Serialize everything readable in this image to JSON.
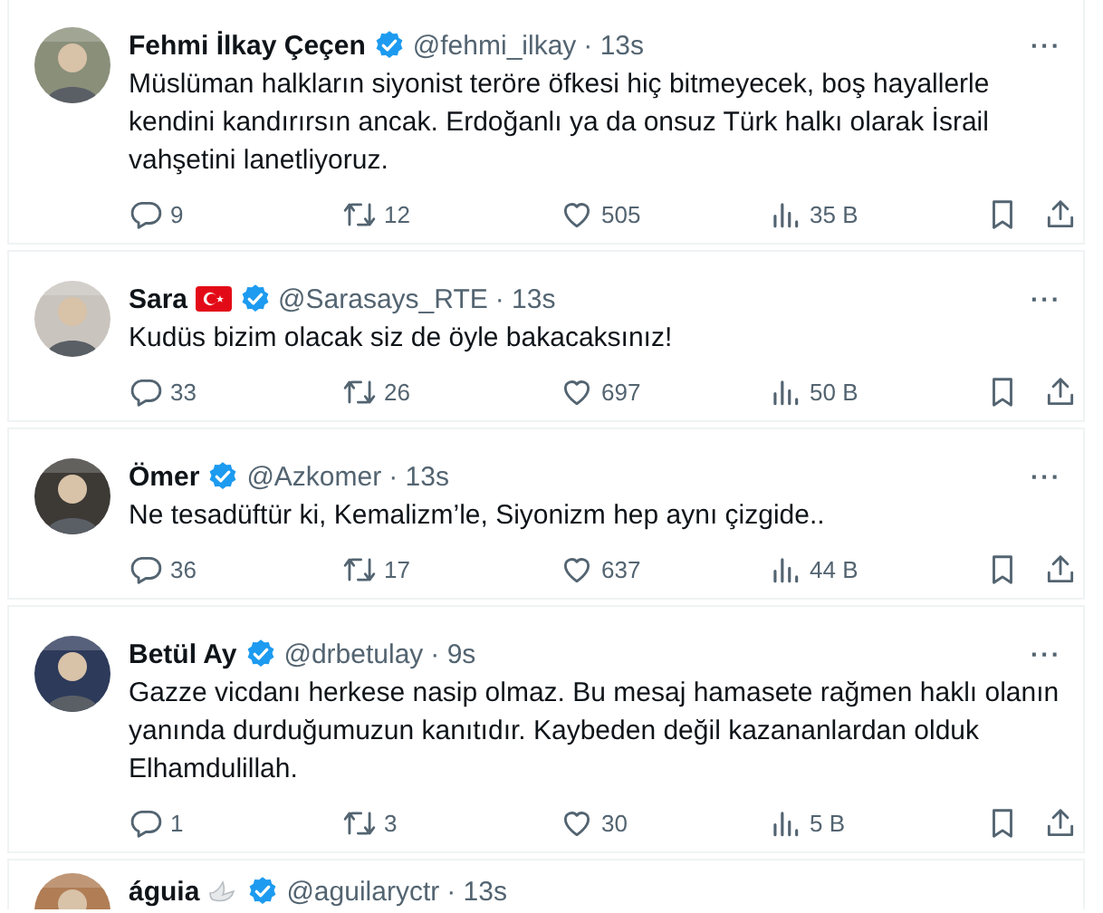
{
  "tweets": [
    {
      "name": "Fehmi İlkay Çeçen",
      "flag_badge": false,
      "dove_badge": false,
      "verified": true,
      "handle": "@fehmi_ilkay",
      "time": "· 13s",
      "more": "···",
      "text": "Müslüman halkların siyonist teröre öfkesi hiç bitmeyecek, boş hayallerle kendini kandırırsın ancak. Erdoğanlı ya da onsuz Türk halkı olarak İsrail vahşetini lanetliyoruz.",
      "replies": "9",
      "reposts": "12",
      "likes": "505",
      "views": "35 B"
    },
    {
      "name": "Sara",
      "flag_badge": true,
      "dove_badge": false,
      "verified": true,
      "handle": "@Sarasays_RTE",
      "time": "· 13s",
      "more": "···",
      "text": "Kudüs bizim olacak siz de öyle bakacaksınız!",
      "replies": "33",
      "reposts": "26",
      "likes": "697",
      "views": "50 B"
    },
    {
      "name": "Ömer",
      "flag_badge": false,
      "dove_badge": false,
      "verified": true,
      "handle": "@Azkomer",
      "time": "· 13s",
      "more": "···",
      "text": "Ne tesadüftür ki, Kemalizm’le, Siyonizm hep aynı çizgide..",
      "replies": "36",
      "reposts": "17",
      "likes": "637",
      "views": "44 B"
    },
    {
      "name": "Betül Ay",
      "flag_badge": false,
      "dove_badge": false,
      "verified": true,
      "handle": "@drbetulay",
      "time": "· 9s",
      "more": "···",
      "text": "Gazze vicdanı herkese nasip olmaz. Bu mesaj hamasete rağmen haklı olanın yanında durduğumuzun kanıtıdır. Kaybeden değil kazananlardan olduk Elhamdulillah.",
      "replies": "1",
      "reposts": "3",
      "likes": "30",
      "views": "5 B"
    },
    {
      "name": "águia",
      "flag_badge": false,
      "dove_badge": true,
      "verified": true,
      "handle": "@aguilaryctr",
      "time": "· 13s"
    }
  ]
}
